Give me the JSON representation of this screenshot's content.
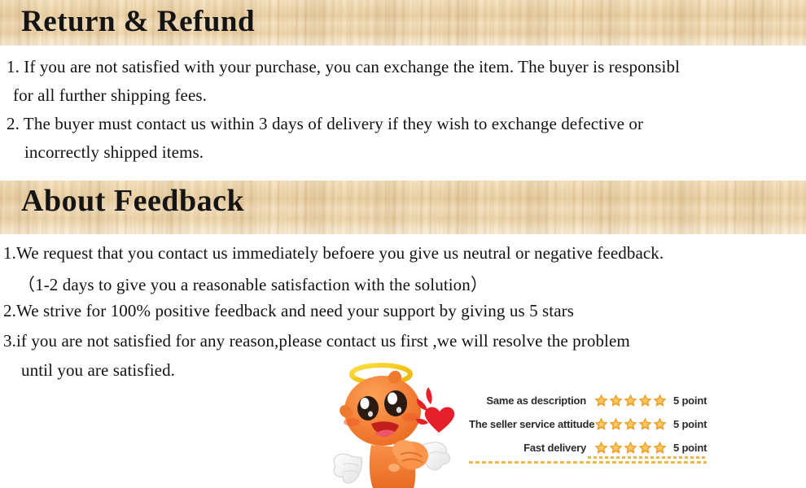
{
  "sections": [
    {
      "id": "return-refund",
      "banner_title": "Return & Refund",
      "lines": [
        "1. If you are not satisfied with your purchase, you can exchange the item. The buyer is responsibl",
        " for all further shipping fees.",
        "2. The buyer must contact us within 3 days of delivery if they wish to exchange defective or",
        "incorrectly shipped items."
      ]
    },
    {
      "id": "about-feedback",
      "banner_title": "About Feedback",
      "lines": [
        "1.We request that you contact us immediately befoere you give us neutral or negative feedback.",
        "（1-2 days to give you a reasonable satisfaction with the solution）",
        "2.We strive for 100% positive feedback and need your support by giving us 5 stars",
        "3.if you are not satisfied for any reason,please contact us first ,we will resolve the problem",
        "until you are satisfied."
      ]
    }
  ],
  "rating": {
    "rows": [
      {
        "label": "Same as description",
        "stars": 5,
        "points": "5 point"
      },
      {
        "label": "The seller service attitude",
        "stars": 5,
        "points": "5 point"
      },
      {
        "label": "Fast delivery",
        "stars": 5,
        "points": "5 point"
      }
    ]
  },
  "mascot": {
    "description": "orange angel character with halo, wings and red heart"
  },
  "colors": {
    "wood_light": "#f7ebd6",
    "wood_mid": "#e7cb9c",
    "star": "#f0a42a",
    "star_light": "#f8c766",
    "dash_line": "#e8bb52",
    "mascot_orange": "#f2712c",
    "mascot_orange_light": "#f9984f",
    "halo_yellow": "#f7d130",
    "heart_red": "#e8232a",
    "text": "#121212"
  }
}
